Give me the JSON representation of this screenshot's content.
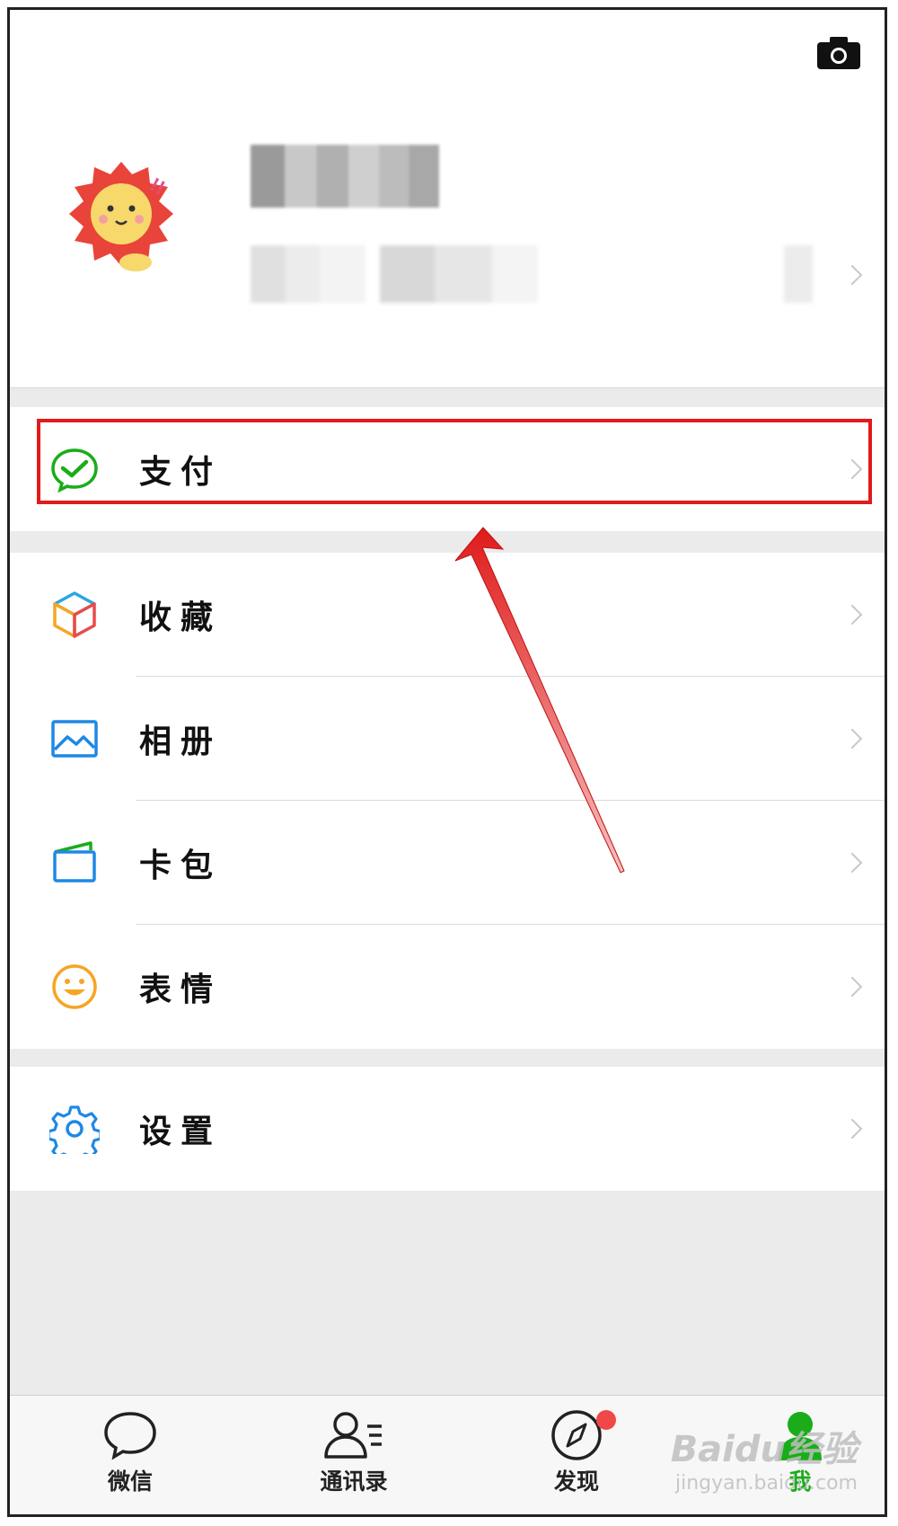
{
  "profile": {
    "camera_icon": "camera-icon",
    "avatar": "cartoon-lion-avatar"
  },
  "menu": {
    "pay": {
      "label": "支付",
      "icon": "wechat-pay-icon",
      "color": "#1aad19"
    },
    "favorites": {
      "label": "收藏",
      "icon": "cube-icon"
    },
    "album": {
      "label": "相册",
      "icon": "photo-icon",
      "color": "#1e88e5"
    },
    "cards": {
      "label": "卡包",
      "icon": "card-icon"
    },
    "stickers": {
      "label": "表情",
      "icon": "smiley-icon",
      "color": "#f5a623"
    },
    "settings": {
      "label": "设置",
      "icon": "gear-icon",
      "color": "#1e88e5"
    }
  },
  "tabbar": {
    "chats": {
      "label": "微信",
      "icon": "chat-bubble-icon"
    },
    "contacts": {
      "label": "通讯录",
      "icon": "contacts-icon"
    },
    "discover": {
      "label": "发现",
      "icon": "compass-icon",
      "badge_color": "#f04848"
    },
    "me": {
      "label": "我",
      "icon": "person-icon",
      "active_color": "#1aad19"
    }
  },
  "annotation": {
    "highlight_color": "#e01b1b"
  },
  "watermark": {
    "line1": "Baidu经验",
    "line2": "jingyan.baidu.com"
  }
}
